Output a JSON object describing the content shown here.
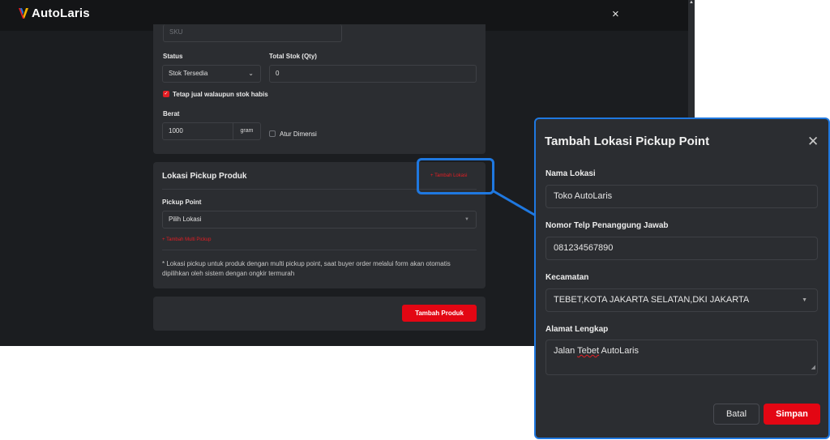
{
  "app": {
    "brand_name": "AutoLaris",
    "close_glyph": "×"
  },
  "product_form": {
    "sku_placeholder": "SKU",
    "status_label": "Status",
    "status_value": "Stok Tersedia",
    "stock_label": "Total Stok (Qty)",
    "stock_value": "0",
    "keep_selling_label": "Tetap jual walaupun stok habis",
    "keep_selling_checked": true,
    "weight_label": "Berat",
    "weight_value": "1000",
    "weight_unit": "gram",
    "dimension_label": "Atur Dimensi",
    "dimension_checked": false
  },
  "pickup_section": {
    "title": "Lokasi Pickup Produk",
    "add_location_link": "+ Tambah Lokasi",
    "pickup_point_label": "Pickup Point",
    "pickup_point_value": "Pilih Lokasi",
    "add_multi_pickup": "+ Tambah Multi Pickup",
    "note": "* Lokasi pickup untuk produk dengan multi pickup point, saat buyer order melalui form akan otomatis dipilihkan oleh sistem dengan ongkir termurah"
  },
  "submit": {
    "add_product_button": "Tambah Produk"
  },
  "modal": {
    "title": "Tambah Lokasi Pickup Point",
    "name_label": "Nama Lokasi",
    "name_value": "Toko AutoLaris",
    "phone_label": "Nomor Telp Penanggung Jawab",
    "phone_value": "081234567890",
    "district_label": "Kecamatan",
    "district_value": "TEBET,KOTA JAKARTA SELATAN,DKI JAKARTA",
    "address_label": "Alamat Lengkap",
    "address_value_prefix": "Jalan ",
    "address_value_word": "Tebet",
    "address_value_suffix": " AutoLaris",
    "cancel_button": "Batal",
    "save_button": "Simpan"
  },
  "colors": {
    "accent_red": "#e30613",
    "highlight_blue": "#1f78e0",
    "dark_bg": "#1b1d20",
    "card_bg": "#2b2d31"
  },
  "icons": {
    "close": "close-icon",
    "chevron": "chevron-down-icon",
    "check": "check-icon"
  }
}
